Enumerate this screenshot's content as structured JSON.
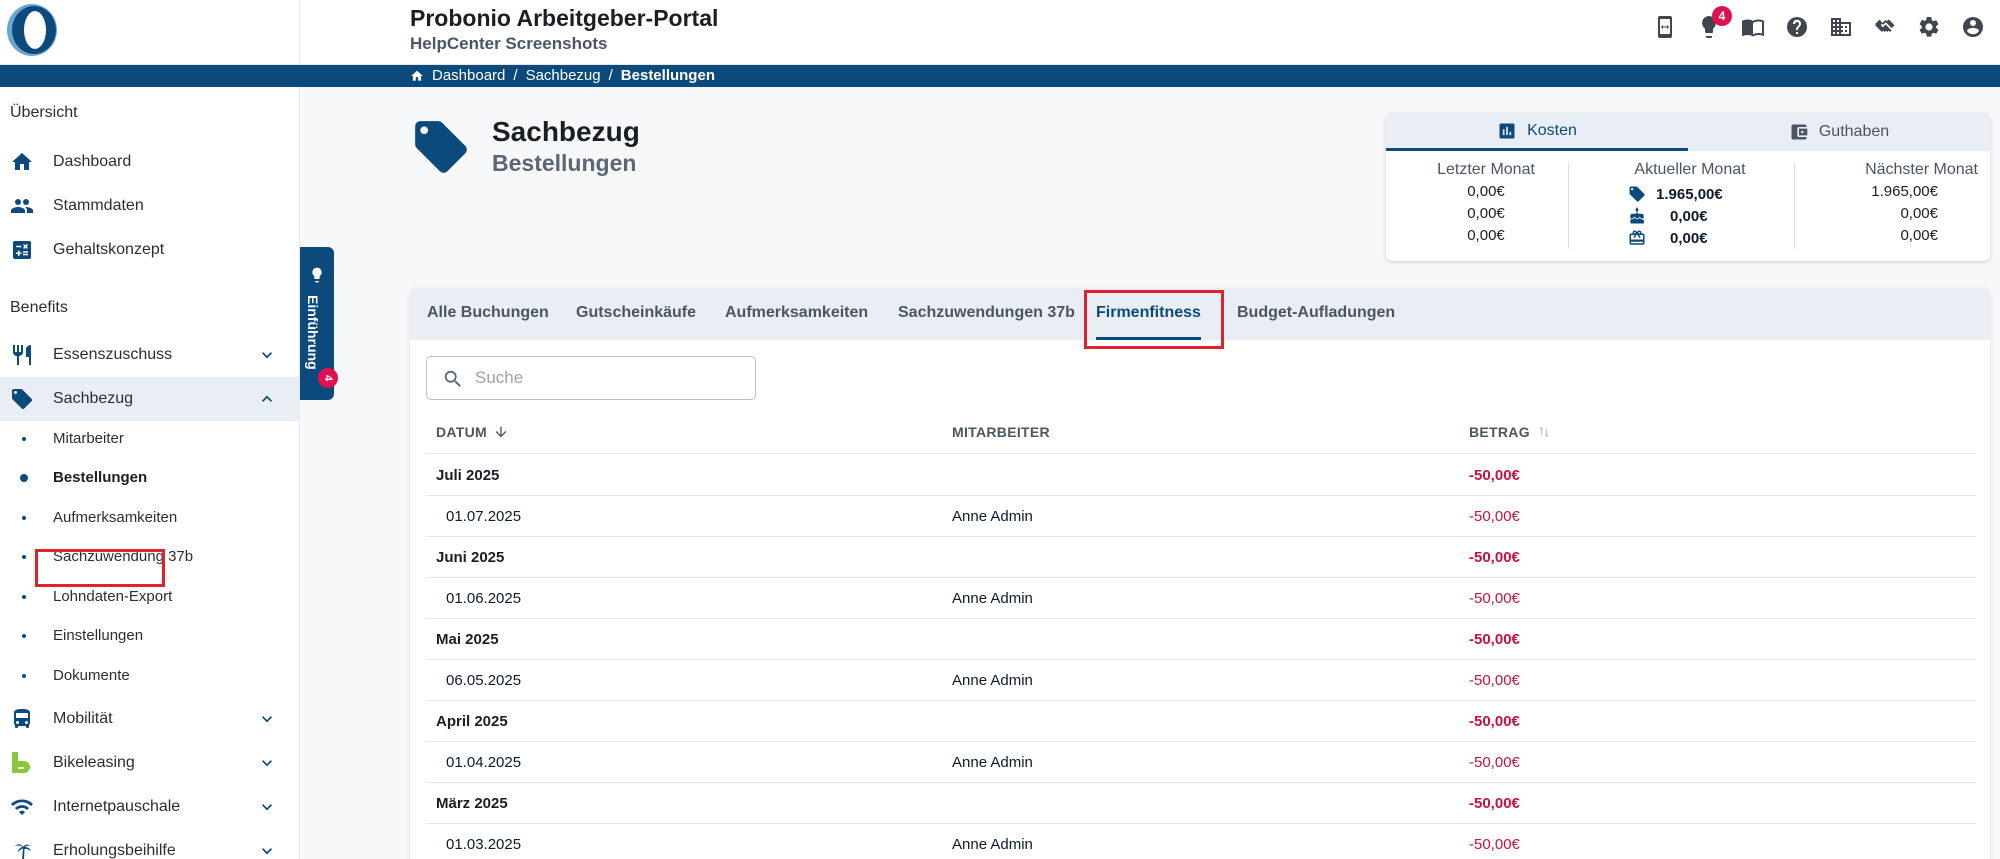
{
  "header": {
    "title": "Probonio Arbeitgeber-Portal",
    "subtitle": "HelpCenter Screenshots",
    "notification_count": "4",
    "icons": [
      "mobile-icon",
      "lightbulb-icon",
      "book-icon",
      "help-icon",
      "building-icon",
      "handshake-icon",
      "settings-icon",
      "account-icon"
    ]
  },
  "breadcrumb": {
    "items": [
      "Dashboard",
      "Sachbezug",
      "Bestellungen"
    ],
    "separator": "/"
  },
  "sidebar": {
    "section_overview": "Übersicht",
    "overview_items": [
      "Dashboard",
      "Stammdaten",
      "Gehaltskonzept"
    ],
    "section_benefits": "Benefits",
    "benefit_items": [
      "Essenszuschuss",
      "Sachbezug",
      "Mobilität",
      "Bikeleasing",
      "Internetpauschale",
      "Erholungsbeihilfe"
    ],
    "sub_items": [
      "Mitarbeiter",
      "Bestellungen",
      "Aufmerksamkeiten",
      "Sachzuwendung 37b",
      "Lohndaten-Export",
      "Einstellungen",
      "Dokumente"
    ]
  },
  "intro_tab": {
    "label": "Einführung",
    "badge": "4"
  },
  "page": {
    "title": "Sachbezug",
    "subtitle": "Bestellungen"
  },
  "cost_card": {
    "tab_costs": "Kosten",
    "tab_balance": "Guthaben",
    "col_last": {
      "header": "Letzter Monat",
      "values": [
        "0,00€",
        "0,00€",
        "0,00€"
      ]
    },
    "col_current": {
      "header": "Aktueller Monat",
      "values": [
        "1.965,00€",
        "0,00€",
        "0,00€"
      ]
    },
    "col_next": {
      "header": "Nächster Monat",
      "values": [
        "1.965,00€",
        "0,00€",
        "0,00€"
      ]
    }
  },
  "tabs": [
    "Alle Buchungen",
    "Gutscheinkäufe",
    "Aufmerksamkeiten",
    "Sachzuwendungen 37b",
    "Firmenfitness",
    "Budget-Aufladungen"
  ],
  "active_tab": "Firmenfitness",
  "search": {
    "placeholder": "Suche",
    "value": ""
  },
  "table": {
    "columns": [
      "DATUM",
      "MITARBEITER",
      "BETRAG"
    ],
    "rows": [
      {
        "type": "group",
        "date": "Juli 2025",
        "employee": "",
        "amount": "-50,00€"
      },
      {
        "type": "item",
        "date": "01.07.2025",
        "employee": "Anne Admin",
        "amount": "-50,00€"
      },
      {
        "type": "group",
        "date": "Juni 2025",
        "employee": "",
        "amount": "-50,00€"
      },
      {
        "type": "item",
        "date": "01.06.2025",
        "employee": "Anne Admin",
        "amount": "-50,00€"
      },
      {
        "type": "group",
        "date": "Mai 2025",
        "employee": "",
        "amount": "-50,00€"
      },
      {
        "type": "item",
        "date": "06.05.2025",
        "employee": "Anne Admin",
        "amount": "-50,00€"
      },
      {
        "type": "group",
        "date": "April 2025",
        "employee": "",
        "amount": "-50,00€"
      },
      {
        "type": "item",
        "date": "01.04.2025",
        "employee": "Anne Admin",
        "amount": "-50,00€"
      },
      {
        "type": "group",
        "date": "März 2025",
        "employee": "",
        "amount": "-50,00€"
      },
      {
        "type": "item",
        "date": "01.03.2025",
        "employee": "Anne Admin",
        "amount": "-50,00€"
      }
    ]
  },
  "colors": {
    "primary": "#0d4a7c",
    "negative_amount": "#c4123e",
    "badge": "#e0114e",
    "highlight": "#e0222f"
  }
}
